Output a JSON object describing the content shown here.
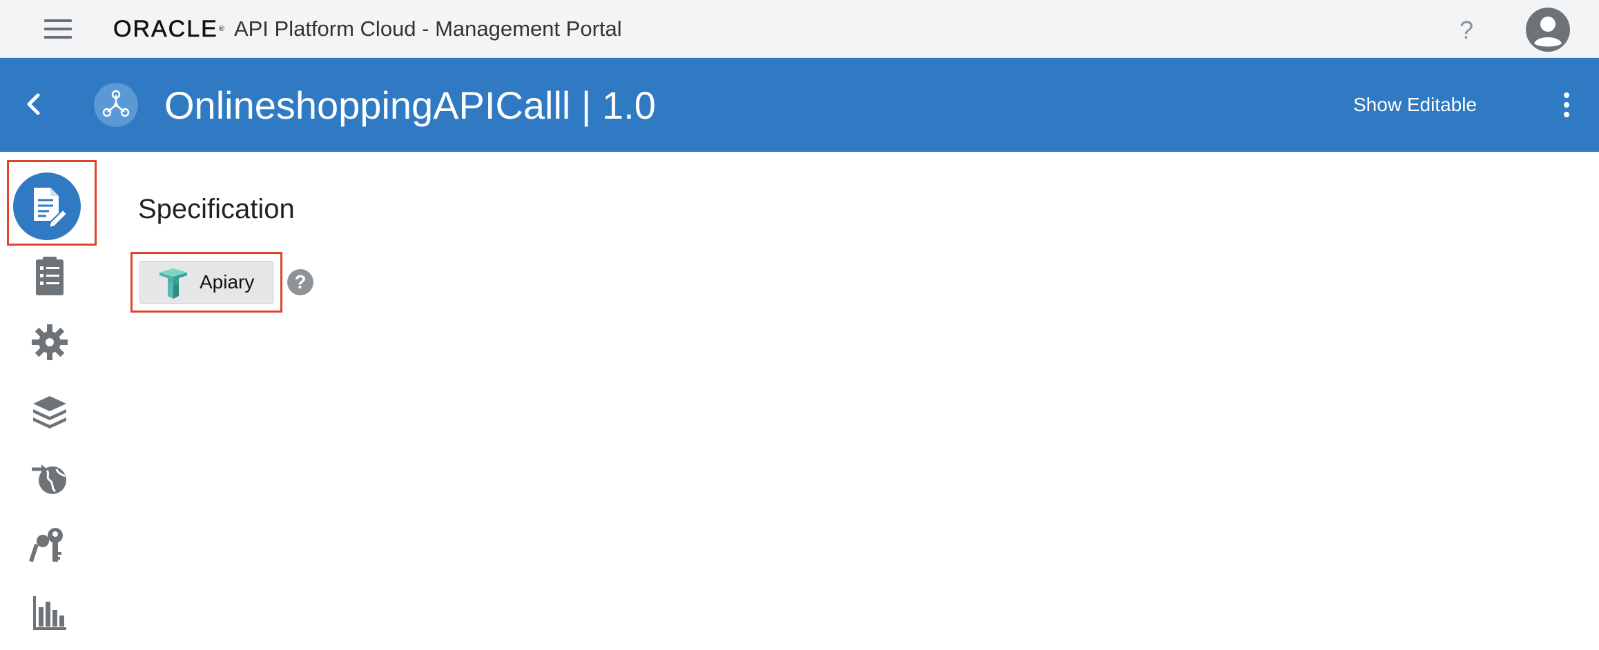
{
  "topbar": {
    "brand_logo": "ORACLE",
    "brand_reg": "®",
    "portal_title": "API Platform Cloud - Management Portal",
    "help_label": "?",
    "menu_icon": "hamburger-icon",
    "avatar_icon": "user-avatar-icon"
  },
  "api_header": {
    "back_icon": "chevron-left-icon",
    "api_icon": "api-nodes-icon",
    "title": "OnlineshoppingAPICalll | 1.0",
    "show_editable_label": "Show Editable",
    "more_icon": "kebab-menu-icon",
    "background_color": "#3079c3"
  },
  "sidebar": {
    "items": [
      {
        "icon": "document-edit-icon",
        "active": true
      },
      {
        "icon": "clipboard-list-icon",
        "active": false
      },
      {
        "icon": "gear-icon",
        "active": false
      },
      {
        "icon": "layers-icon",
        "active": false
      },
      {
        "icon": "globe-deploy-icon",
        "active": false
      },
      {
        "icon": "keys-icon",
        "active": false
      },
      {
        "icon": "bar-chart-icon",
        "active": false
      }
    ]
  },
  "main": {
    "section_title": "Specification",
    "apiary_button_label": "Apiary",
    "apiary_icon": "apiary-logo-icon",
    "help_label": "?"
  },
  "highlight_color": "#e0432c"
}
